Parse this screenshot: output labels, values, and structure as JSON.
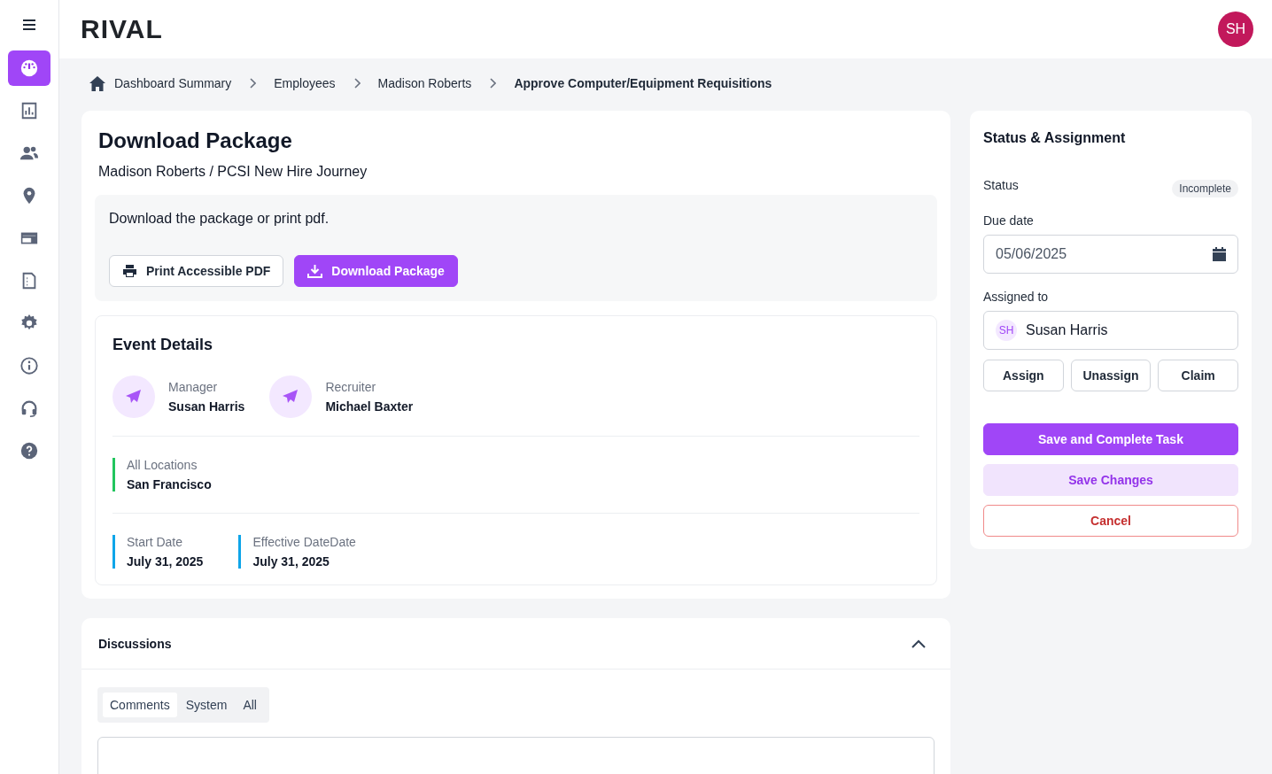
{
  "logo": "RIVAL",
  "user_avatar": "SH",
  "nav": [
    {
      "selected": true
    },
    {
      "selected": false
    },
    {
      "selected": false
    },
    {
      "selected": false
    },
    {
      "selected": false
    },
    {
      "selected": false
    },
    {
      "selected": false
    },
    {
      "selected": false
    },
    {
      "selected": false
    },
    {
      "selected": false
    }
  ],
  "breadcrumb": [
    "Dashboard Summary",
    "Employees",
    "Madison Roberts",
    "Approve Computer/Equipment Requisitions"
  ],
  "task": {
    "title": "Download Package",
    "subtitle": "Madison Roberts / PCSI New Hire Journey",
    "instructions": "Download the package or print pdf.",
    "buttons": [
      {
        "kind": "secondary",
        "label": "Print Accessible PDF"
      },
      {
        "kind": "primary",
        "label": "Download Package"
      }
    ]
  },
  "event_details": {
    "title": "Event Details",
    "people": [
      {
        "label": "Manager",
        "value": "Susan Harris"
      },
      {
        "label": "Recruiter",
        "value": "Michael Baxter"
      }
    ],
    "locations": [
      {
        "label": "All Locations",
        "value": "San Francisco",
        "color": "#22c55e"
      }
    ],
    "dates": [
      {
        "label": "Start Date",
        "value": "July 31, 2025",
        "color": "#0ea5e9"
      },
      {
        "label": "Effective DateDate",
        "value": "July 31, 2025",
        "color": "#0ea5e9"
      }
    ]
  },
  "discussions": {
    "title": "Discussions",
    "expanded": true,
    "tabs": [
      {
        "label": "Comments",
        "selected": true
      },
      {
        "label": "System",
        "selected": false
      },
      {
        "label": "All",
        "selected": false
      }
    ]
  },
  "status_panel": {
    "title": "Status & Assignment",
    "status_label": "Status",
    "status": "Incomplete",
    "due_label": "Due date",
    "due_date": "05/06/2025",
    "assigned_label": "Assigned to",
    "assignee_initials": "SH",
    "assignee": "Susan Harris",
    "assign_buttons": [
      "Assign",
      "Unassign",
      "Claim"
    ],
    "actions": [
      {
        "kind": "primary",
        "label": "Save and Complete Task"
      },
      {
        "kind": "soft",
        "label": "Save Changes"
      },
      {
        "kind": "danger",
        "label": "Cancel"
      }
    ]
  }
}
